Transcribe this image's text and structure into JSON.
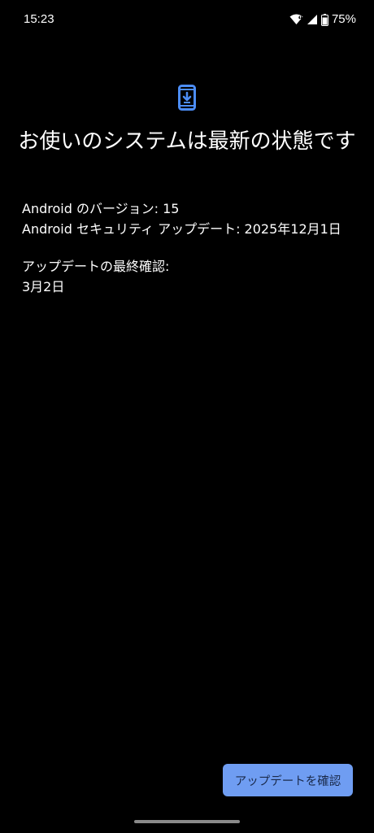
{
  "status_bar": {
    "time": "15:23",
    "battery_percent": "75%",
    "icons": [
      "wifi-icon",
      "signal-icon",
      "battery-icon"
    ]
  },
  "hero": {
    "icon": "system-update-icon",
    "accent_color": "#4c8df6"
  },
  "main": {
    "title": "お使いのシステムは最新の状態です",
    "android_version": "Android のバージョン: 15",
    "security_update": "Android セキュリティ アップデート: 2025年12月1日",
    "last_check_label": "アップデートの最終確認:",
    "last_check_date": "3月2日"
  },
  "actions": {
    "check_update_label": "アップデートを確認",
    "button_color": "#6f9df2"
  }
}
